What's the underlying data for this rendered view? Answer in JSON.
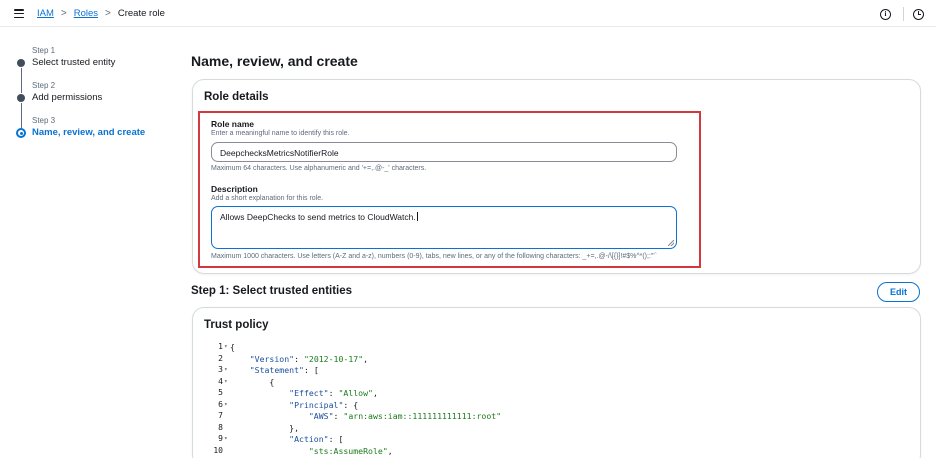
{
  "breadcrumb": {
    "iam": "IAM",
    "roles": "Roles",
    "current": "Create role",
    "sep": ">"
  },
  "top_icons": {
    "info": "i",
    "info_icon": "info-icon",
    "settings_icon": "clock-icon"
  },
  "steps": [
    {
      "label": "Step 1",
      "name": "Select trusted entity",
      "active": false
    },
    {
      "label": "Step 2",
      "name": "Add permissions",
      "active": false
    },
    {
      "label": "Step 3",
      "name": "Name, review, and create",
      "active": true
    }
  ],
  "page_title": "Name, review, and create",
  "role_details": {
    "title": "Role details",
    "role_name": {
      "label": "Role name",
      "hint": "Enter a meaningful name to identify this role.",
      "value": "DeepchecksMetricsNotifierRole",
      "constraint": "Maximum 64 characters. Use alphanumeric and '+=,.@-_' characters."
    },
    "description": {
      "label": "Description",
      "hint": "Add a short explanation for this role.",
      "value": "Allows DeepChecks to send metrics to CloudWatch.",
      "constraint": "Maximum 1000 characters. Use letters (A-Z and a-z), numbers (0-9), tabs, new lines, or any of the following characters: _+=,.@-/\\[{}]!#$%^*();:\"'`"
    },
    "highlight_color": "#d1393d"
  },
  "step1": {
    "title": "Step 1: Select trusted entities",
    "edit_label": "Edit"
  },
  "trust_policy": {
    "title": "Trust policy",
    "lines": [
      {
        "n": "1",
        "fold": true,
        "text": "{"
      },
      {
        "n": "2",
        "fold": false,
        "text": "    \"Version\": \"2012-10-17\","
      },
      {
        "n": "3",
        "fold": true,
        "text": "    \"Statement\": ["
      },
      {
        "n": "4",
        "fold": true,
        "text": "        {"
      },
      {
        "n": "5",
        "fold": false,
        "text": "            \"Effect\": \"Allow\","
      },
      {
        "n": "6",
        "fold": true,
        "text": "            \"Principal\": {"
      },
      {
        "n": "7",
        "fold": false,
        "text": "                \"AWS\": \"arn:aws:iam::111111111111:root\""
      },
      {
        "n": "8",
        "fold": false,
        "text": "            },"
      },
      {
        "n": "9",
        "fold": true,
        "text": "            \"Action\": ["
      },
      {
        "n": "10",
        "fold": false,
        "text": "                \"sts:AssumeRole\","
      }
    ]
  },
  "colors": {
    "accent": "#0972d3",
    "text": "#16191f",
    "muted": "#5f6b7a"
  }
}
